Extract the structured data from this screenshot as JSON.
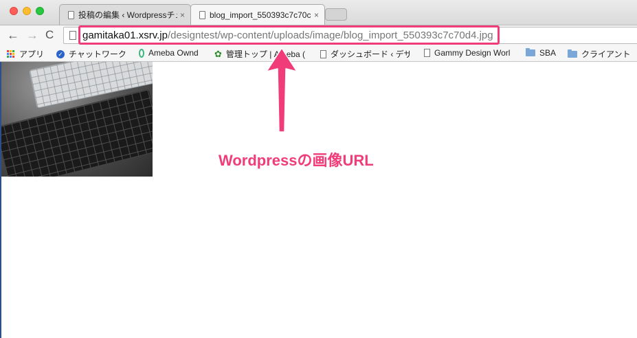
{
  "window": {
    "tabs": [
      {
        "label": "投稿の編集 ‹ Wordpressチュ",
        "close": "×",
        "active": false
      },
      {
        "label": "blog_import_550393c7c70c",
        "close": "×",
        "active": true
      }
    ]
  },
  "toolbar": {
    "back": "←",
    "forward": "→",
    "reload": "C",
    "url_host": "gamitaka01.xsrv.jp",
    "url_path": "/designtest/wp-content/uploads/image/blog_import_550393c7c70d4.jpg"
  },
  "bookmarks": [
    {
      "icon": "apps-grid-icon",
      "label": "アプリ"
    },
    {
      "icon": "chatwork-icon",
      "label": "チャットワーク"
    },
    {
      "icon": "ameba-ownd-icon",
      "label": "Ameba Ownd"
    },
    {
      "icon": "ameba-clover-icon",
      "label": "管理トップ | Ameba ("
    },
    {
      "icon": "page-icon",
      "label": "ダッシュボード ‹ デザ"
    },
    {
      "icon": "page-icon",
      "label": "Gammy Design Worl"
    },
    {
      "icon": "folder-icon",
      "label": "SBA"
    },
    {
      "icon": "folder-icon",
      "label": "クライアント"
    }
  ],
  "annotation": {
    "text": "Wordpressの画像URL",
    "color": "#f03c78"
  },
  "colors": {
    "accent": "#f03c78",
    "chrome_bg": "#f6f6f6"
  }
}
